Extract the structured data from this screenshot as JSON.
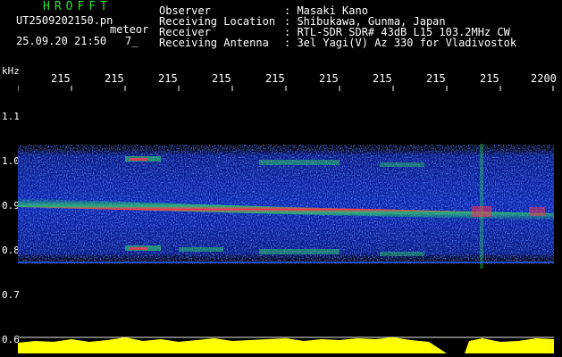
{
  "header": {
    "app_title": "HROFFT",
    "file_name": "UT2509202150.pn",
    "file_tag": "meteor",
    "date_time": "25.09.20 21:50",
    "count": "7_",
    "fields": [
      {
        "label": "Observer",
        "value": ": Masaki Kano"
      },
      {
        "label": "Receiving Location",
        "value": ": Shibukawa, Gunma, Japan"
      },
      {
        "label": "Receiver",
        "value": ": RTL-SDR SDR# 43dB L15 103.2MHz CW"
      },
      {
        "label": "Receiving Antenna",
        "value": ": 3el Yagi(V) Az 330 for Vladivostok"
      }
    ]
  },
  "axes": {
    "y_unit": "kHz",
    "y_ticks": [
      "1.1",
      "1.0",
      "0.9",
      "0.8",
      "0.7",
      "0.6"
    ],
    "x_ticks": [
      "215",
      "215",
      "215",
      "215",
      "215",
      "215",
      "215",
      "215",
      "215",
      "2200"
    ]
  },
  "colors": {
    "background": "#000000",
    "header_green": "#27e32f",
    "signal_peak": "#ff3050",
    "signal_mid": "#30e060",
    "noise": "#1c3cff",
    "level_bar": "#ffff00"
  }
}
